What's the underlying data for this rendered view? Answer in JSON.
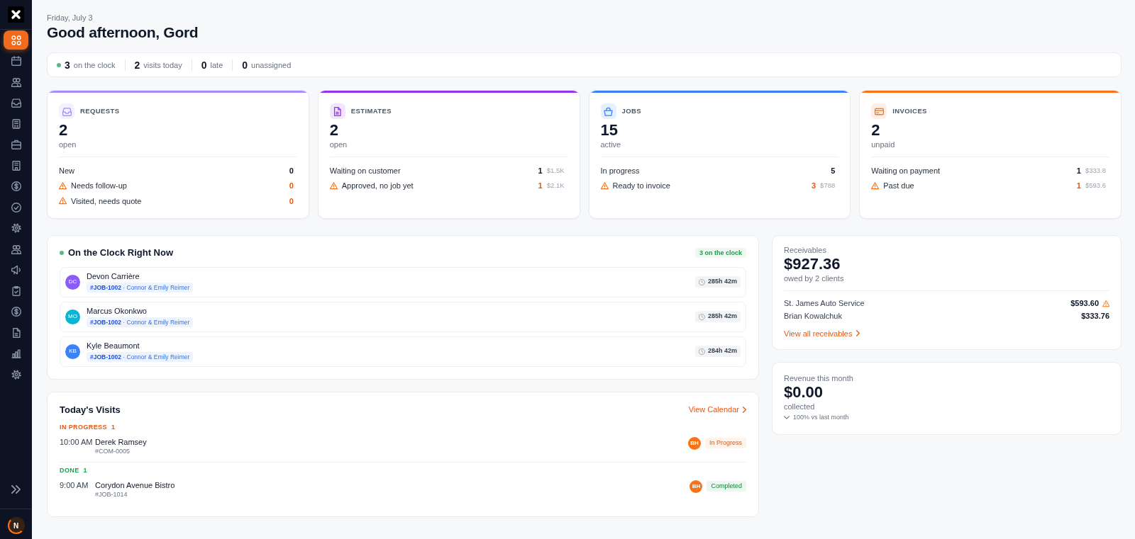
{
  "sidebar": {
    "nav_items": [
      {
        "kind": "grid",
        "selected": true
      },
      {
        "kind": "calendar",
        "selected": false
      },
      {
        "kind": "people",
        "selected": false
      },
      {
        "kind": "inbox",
        "selected": false
      },
      {
        "kind": "receipt",
        "selected": false
      },
      {
        "kind": "briefcase",
        "selected": false
      },
      {
        "kind": "building",
        "selected": false
      },
      {
        "kind": "dollar",
        "selected": false
      },
      {
        "kind": "check",
        "selected": false
      },
      {
        "kind": "gear",
        "selected": false
      },
      {
        "kind": "people",
        "selected": false
      },
      {
        "kind": "megaphone",
        "selected": false
      },
      {
        "kind": "clipboard",
        "selected": false
      },
      {
        "kind": "dollar",
        "selected": false
      },
      {
        "kind": "document",
        "selected": false
      },
      {
        "kind": "chart",
        "selected": false
      },
      {
        "kind": "gear",
        "selected": false
      }
    ],
    "user": {
      "initial": "N"
    }
  },
  "header": {
    "date": "Friday, July 3",
    "greeting": "Good afternoon, Gord"
  },
  "summary": [
    {
      "value": "3",
      "label": "on the clock",
      "live": true
    },
    {
      "value": "2",
      "label": "visits today",
      "live": false
    },
    {
      "value": "0",
      "label": "late",
      "live": false
    },
    {
      "value": "0",
      "label": "unassigned",
      "live": false
    }
  ],
  "cards": [
    {
      "kind": "inbox",
      "title": "REQUESTS",
      "color": "#a78bfa",
      "count": "2",
      "count_label": "open",
      "rows": [
        {
          "label": "New",
          "count": "0",
          "warning": false
        },
        {
          "label": "Needs follow-up",
          "count": "0",
          "warning": true
        },
        {
          "label": "Visited, needs quote",
          "count": "0",
          "warning": true
        }
      ]
    },
    {
      "kind": "document",
      "title": "ESTIMATES",
      "color": "#9333ea",
      "count": "2",
      "count_label": "open",
      "rows": [
        {
          "label": "Waiting on customer",
          "count": "1",
          "amount": "$1.5K",
          "warning": false
        },
        {
          "label": "Approved, no job yet",
          "count": "1",
          "amount": "$2.1K",
          "warning": true
        }
      ]
    },
    {
      "kind": "basket",
      "title": "JOBS",
      "color": "#3b82f6",
      "count": "15",
      "count_label": "active",
      "rows": [
        {
          "label": "In progress",
          "count": "5",
          "warning": false
        },
        {
          "label": "Ready to invoice",
          "count": "3",
          "amount": "$788",
          "warning": true
        }
      ]
    },
    {
      "kind": "card",
      "title": "INVOICES",
      "color": "#f97316",
      "count": "2",
      "count_label": "unpaid",
      "rows": [
        {
          "label": "Waiting on payment",
          "count": "1",
          "amount": "$333.8",
          "warning": false
        },
        {
          "label": "Past due",
          "count": "1",
          "amount": "$593.6",
          "warning": true
        }
      ]
    }
  ],
  "on_the_clock": {
    "title": "On the Clock Right Now",
    "badge": "3 on the clock",
    "people": [
      {
        "initials": "DC",
        "name": "Devon Carrière",
        "color": "#8b5cf6",
        "tag": "**#JOB-1002** · Connor & Emily Reimer",
        "duration": "285h 42m"
      },
      {
        "initials": "MO",
        "name": "Marcus Okonkwo",
        "color": "#06b6d4",
        "tag": "**#JOB-1002** · Connor & Emily Reimer",
        "duration": "285h 42m"
      },
      {
        "initials": "KB",
        "name": "Kyle Beaumont",
        "color": "#3b82f6",
        "tag": "**#JOB-1002** · Connor & Emily Reimer",
        "duration": "284h 42m"
      }
    ]
  },
  "todays_visits": {
    "title": "Today's Visits",
    "link": "View Calendar",
    "groups": [
      {
        "kind": "in_progress",
        "label": "IN PROGRESS",
        "count": "1",
        "visits": [
          {
            "time": "10:00 AM",
            "name": "Derek Ramsey",
            "ref": "#COM-0005",
            "assignee": "BH",
            "status": "In Progress"
          }
        ]
      },
      {
        "kind": "done",
        "label": "DONE",
        "count": "1",
        "visits": [
          {
            "time": "9:00 AM",
            "name": "Corydon Avenue Bistro",
            "ref": "#JOB-1014",
            "assignee": "BH",
            "status": "Completed"
          }
        ]
      }
    ]
  },
  "receivables": {
    "label": "Receivables",
    "amount": "$927.36",
    "note": "owed by 2 clients",
    "clients": [
      {
        "name": "St. James Auto Service",
        "amount": "$593.60",
        "overdue": true
      },
      {
        "name": "Brian Kowalchuk",
        "amount": "$333.76",
        "overdue": false
      }
    ],
    "link": "View all receivables"
  },
  "revenue": {
    "label": "Revenue this month",
    "amount": "$0.00",
    "note": "collected",
    "trend": "100% vs last month",
    "trend_down": true
  }
}
